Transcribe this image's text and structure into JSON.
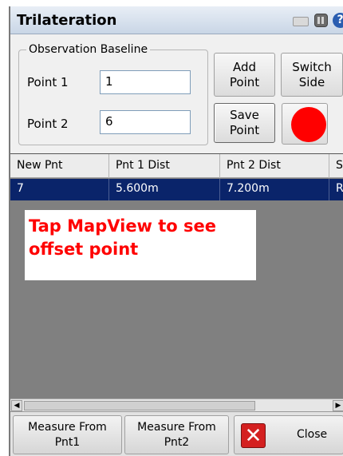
{
  "window": {
    "title": "Trilateration"
  },
  "icons": {
    "keyboard": "keyboard-icon",
    "grid": "apps-icon",
    "help": "help-icon"
  },
  "baseline": {
    "legend": "Observation Baseline",
    "point1_label": "Point 1",
    "point1_value": "1",
    "point2_label": "Point 2",
    "point2_value": "6"
  },
  "buttons": {
    "add_point": "Add\nPoint",
    "switch_side": "Switch\nSide",
    "save_point": "Save\nPoint",
    "measure_pnt1": "Measure From\nPnt1",
    "measure_pnt2": "Measure From\nPnt2",
    "close": "Close"
  },
  "table": {
    "columns": [
      "New Pnt",
      "Pnt 1 Dist",
      "Pnt 2 Dist",
      "S"
    ],
    "rows": [
      [
        "7",
        "5.600m",
        "7.200m",
        "R"
      ]
    ]
  },
  "message": "Tap MapView to see offset point",
  "colors": {
    "status_dot": "#ff0000",
    "selection": "#0a246a",
    "message_text": "#ff0000"
  }
}
